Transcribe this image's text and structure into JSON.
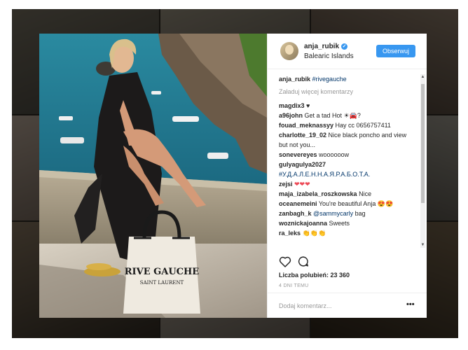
{
  "post": {
    "username": "anja_rubik",
    "verified_mark": "✓",
    "location": "Balearic Islands",
    "follow_label": "Obserwuj",
    "caption_user": "anja_rubik",
    "caption_tag": "#rivegauche",
    "load_more": "Załaduj więcej komentarzy",
    "comments": [
      {
        "user": "magdix3",
        "text": " ♥"
      },
      {
        "user": "a96john",
        "text": " Get a tad Hot ☀🚘?"
      },
      {
        "user": "fouad_meknassyy",
        "text": " Hay cc 0656757411"
      },
      {
        "user": "charlotte_19_02",
        "text": " Nice black poncho and view but not you..."
      },
      {
        "user": "sonevereyes",
        "text": " woooooow"
      },
      {
        "user": "gulyagulya2027",
        "text": " ",
        "link": "#У.Д.А.Л.Е.Н.Н.А.Я.Р.А.Б.О.Т.А."
      },
      {
        "user": "zejsi",
        "text": " ❤❤❤"
      },
      {
        "user": "maja_izabela_roszkowska",
        "text": " Nice"
      },
      {
        "user": "oceanemeini",
        "text": " You're beautiful Anja 😍😍"
      },
      {
        "user": "zanbagh_k",
        "text": " bag",
        "link": "@sammycarly"
      },
      {
        "user": "woznickajoanna",
        "text": " Sweets"
      },
      {
        "user": "ra_leks",
        "text": " 👏👏👏"
      }
    ],
    "likes_label": "Liczba polubień: 23 360",
    "time_label": "4 DNI TEMU",
    "comment_placeholder": "Dodaj komentarz...",
    "more_label": "•••",
    "photo_text_1": "RIVE GAUCHE",
    "photo_text_2": "SAINT LAURENT"
  },
  "colors": {
    "accent": "#3897f0",
    "heart": "#ed4956",
    "sea": "#1c6d84"
  },
  "icons": [
    "heart-icon",
    "comment-icon",
    "verified-badge-icon",
    "more-options-icon",
    "scroll-up-icon",
    "scroll-down-icon"
  ]
}
